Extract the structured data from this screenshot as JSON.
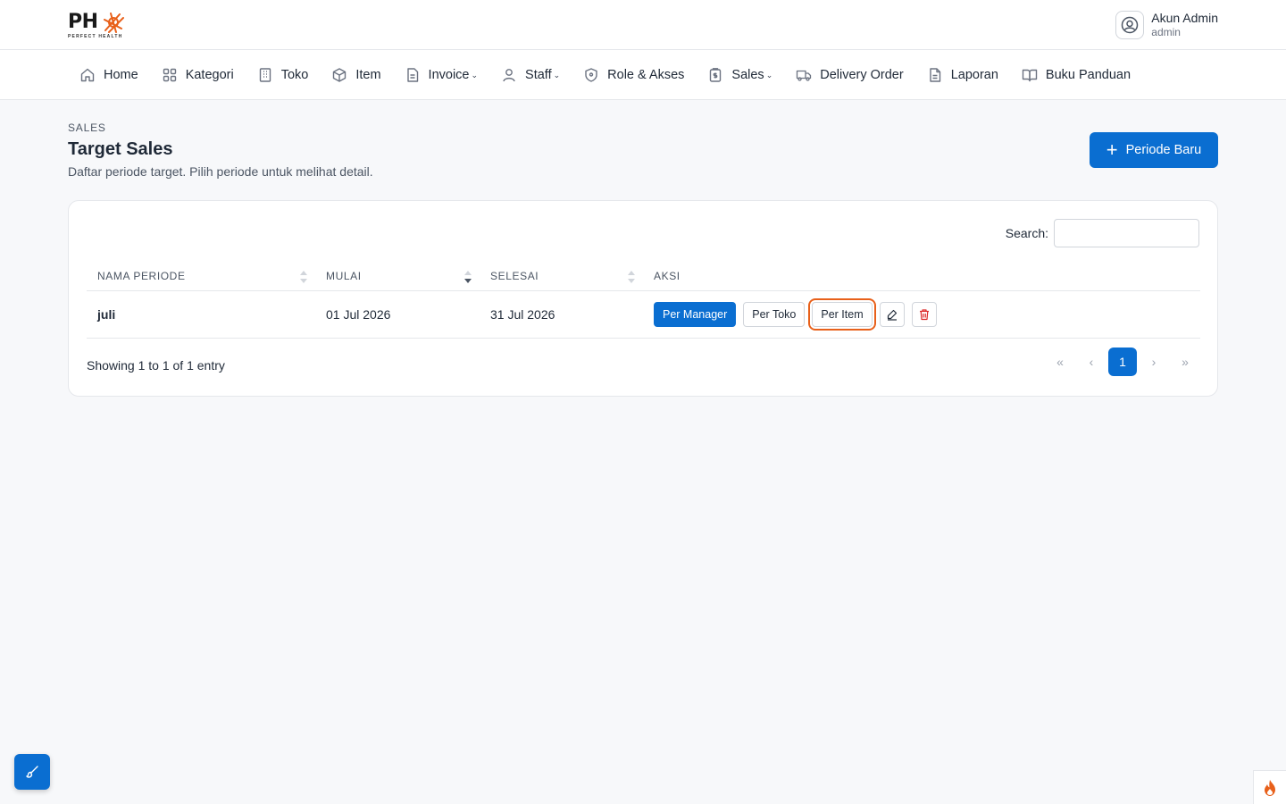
{
  "brand": {
    "logo_text": "PH",
    "logo_sub": "PERFECT HEALTH"
  },
  "user": {
    "name": "Akun Admin",
    "role": "admin"
  },
  "nav": {
    "items": [
      {
        "label": "Home",
        "icon": "home-icon"
      },
      {
        "label": "Kategori",
        "icon": "grid-icon"
      },
      {
        "label": "Toko",
        "icon": "building-icon"
      },
      {
        "label": "Item",
        "icon": "box-icon"
      },
      {
        "label": "Invoice",
        "icon": "file-icon",
        "dropdown": true
      },
      {
        "label": "Staff",
        "icon": "person-icon",
        "dropdown": true
      },
      {
        "label": "Role & Akses",
        "icon": "shield-icon"
      },
      {
        "label": "Sales",
        "icon": "clipboard-dollar-icon",
        "dropdown": true
      },
      {
        "label": "Delivery Order",
        "icon": "truck-icon"
      },
      {
        "label": "Laporan",
        "icon": "document-icon"
      },
      {
        "label": "Buku Panduan",
        "icon": "book-icon"
      }
    ],
    "caret": "⌄"
  },
  "page": {
    "breadcrumb": "SALES",
    "title": "Target Sales",
    "subtitle": "Daftar periode target. Pilih periode untuk melihat detail.",
    "new_button": "Periode Baru"
  },
  "table": {
    "search_label": "Search:",
    "search_value": "",
    "headers": [
      "NAMA PERIODE",
      "MULAI",
      "SELESAI",
      "AKSI"
    ],
    "rows": [
      {
        "nama": "juli",
        "mulai": "01 Jul 2026",
        "selesai": "31 Jul 2026"
      }
    ],
    "actions": {
      "per_manager": "Per Manager",
      "per_toko": "Per Toko",
      "per_item": "Per Item"
    },
    "info": "Showing 1 to 1 of 1 entry",
    "pager": {
      "first": "«",
      "prev": "‹",
      "current": "1",
      "next": "›",
      "last": "»"
    }
  },
  "colors": {
    "primary": "#0a6ed1",
    "highlight": "#e8601a",
    "danger": "#dc2626"
  }
}
